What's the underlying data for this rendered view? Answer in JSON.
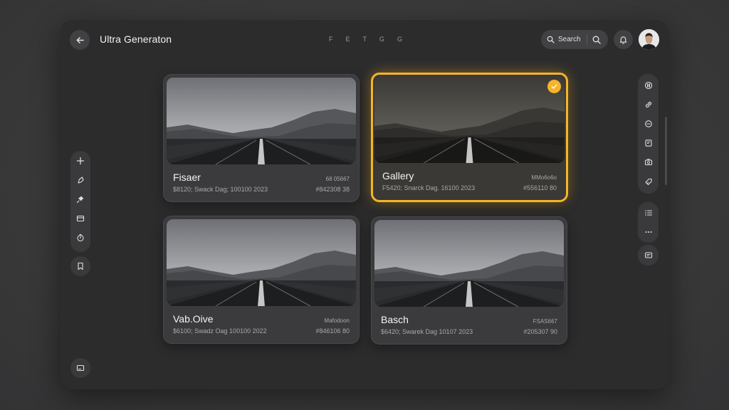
{
  "header": {
    "title": "Ultra Generaton",
    "center_tabs": [
      "F",
      "E",
      "T",
      "G",
      "G"
    ],
    "search_label": "Search"
  },
  "icons": {
    "back": "arrow-left-icon",
    "search": "search-icon",
    "bell": "bell-icon",
    "left_tools": [
      "plus-icon",
      "shape-icon",
      "pin-icon",
      "card-icon",
      "timer-icon"
    ],
    "left_single": "bookmark-icon",
    "left_bottom": "image-icon",
    "right_tools": [
      "columns-icon",
      "link-icon",
      "minus-circle-icon",
      "note-icon",
      "camera-icon",
      "tag-icon"
    ],
    "right_tools2": [
      "list-icon",
      "more-icon"
    ],
    "right_single": "comment-icon"
  },
  "colors": {
    "accent": "#f5b42a",
    "background": "#2c2c2d",
    "panel": "#3b3b3d"
  },
  "cards": [
    {
      "name": "Fisaer",
      "meta": "$8120; Swack Dag; 100100 2023",
      "code": "68 05667",
      "id": "#842308 38",
      "selected": false
    },
    {
      "name": "Gallery",
      "meta": "F5420; Snarck Dag. 16100 2023",
      "code": "MMo6o6o",
      "id": "#556110 80",
      "selected": true
    },
    {
      "name": "Vab.Oive",
      "meta": "$6100; Swadz Oag 100100 2022",
      "code": "Mafodoon",
      "id": "#846106 80",
      "selected": false
    },
    {
      "name": "Basch",
      "meta": "$6420; Swarek Dag 10107 2023",
      "code": "FSAS667",
      "id": "#205307 90",
      "selected": false
    }
  ]
}
